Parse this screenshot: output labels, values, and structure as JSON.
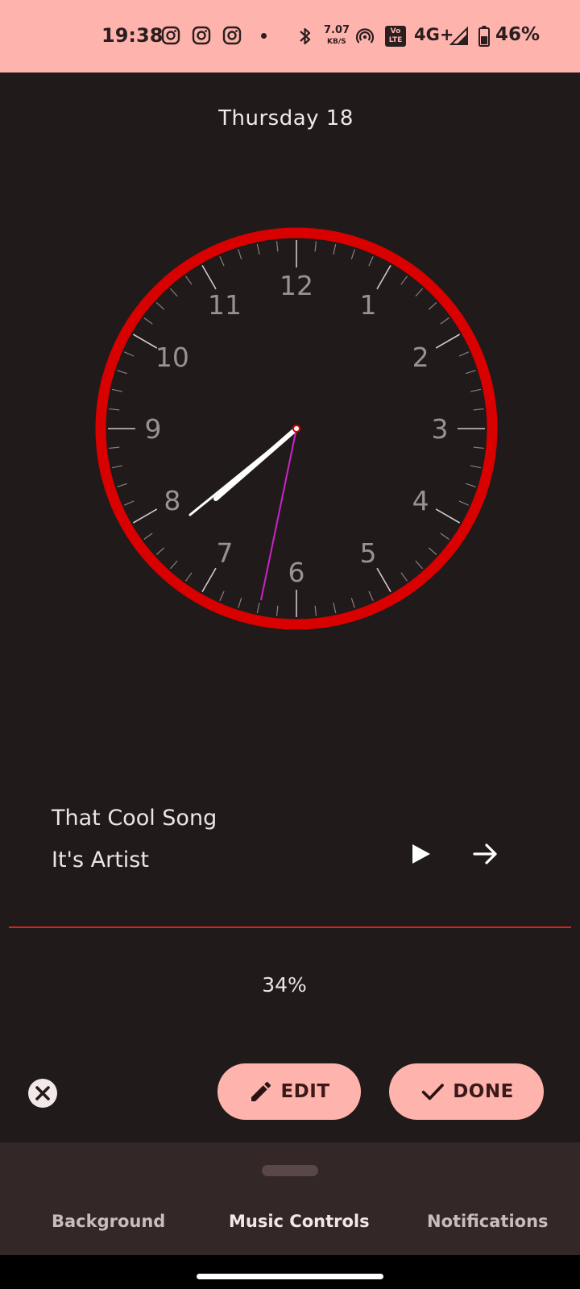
{
  "status_bar": {
    "time": "19:38",
    "net_speed_value": "7.07",
    "net_speed_unit": "KB/S",
    "volte_top": "Vo",
    "volte_bottom": "LTE",
    "network": "4G+",
    "battery": "46%",
    "icons": [
      "instagram-icon",
      "instagram-icon",
      "instagram-icon",
      "dot-icon",
      "bluetooth-icon",
      "hotspot-icon",
      "volte-icon",
      "signal-icon",
      "battery-icon"
    ]
  },
  "clock": {
    "date": "Thursday 18",
    "numbers": [
      "12",
      "1",
      "2",
      "3",
      "4",
      "5",
      "6",
      "7",
      "8",
      "9",
      "10",
      "11"
    ],
    "ring_color": "#D90000",
    "second_hand_color": "#CC22CC"
  },
  "music": {
    "title": "That Cool Song",
    "artist": "It's Artist",
    "play_icon": "play-icon",
    "next_icon": "arrow-right-icon"
  },
  "battery_widget": {
    "percent": "34%"
  },
  "actions": {
    "edit_label": "EDIT",
    "done_label": "DONE"
  },
  "bottom_sheet": {
    "tabs": [
      "Background",
      "Music Controls",
      "Notifications"
    ],
    "selected_tab": "Music Controls"
  },
  "colors": {
    "accent": "#FFB3AD",
    "background": "#211A1A",
    "divider": "#D32424"
  }
}
